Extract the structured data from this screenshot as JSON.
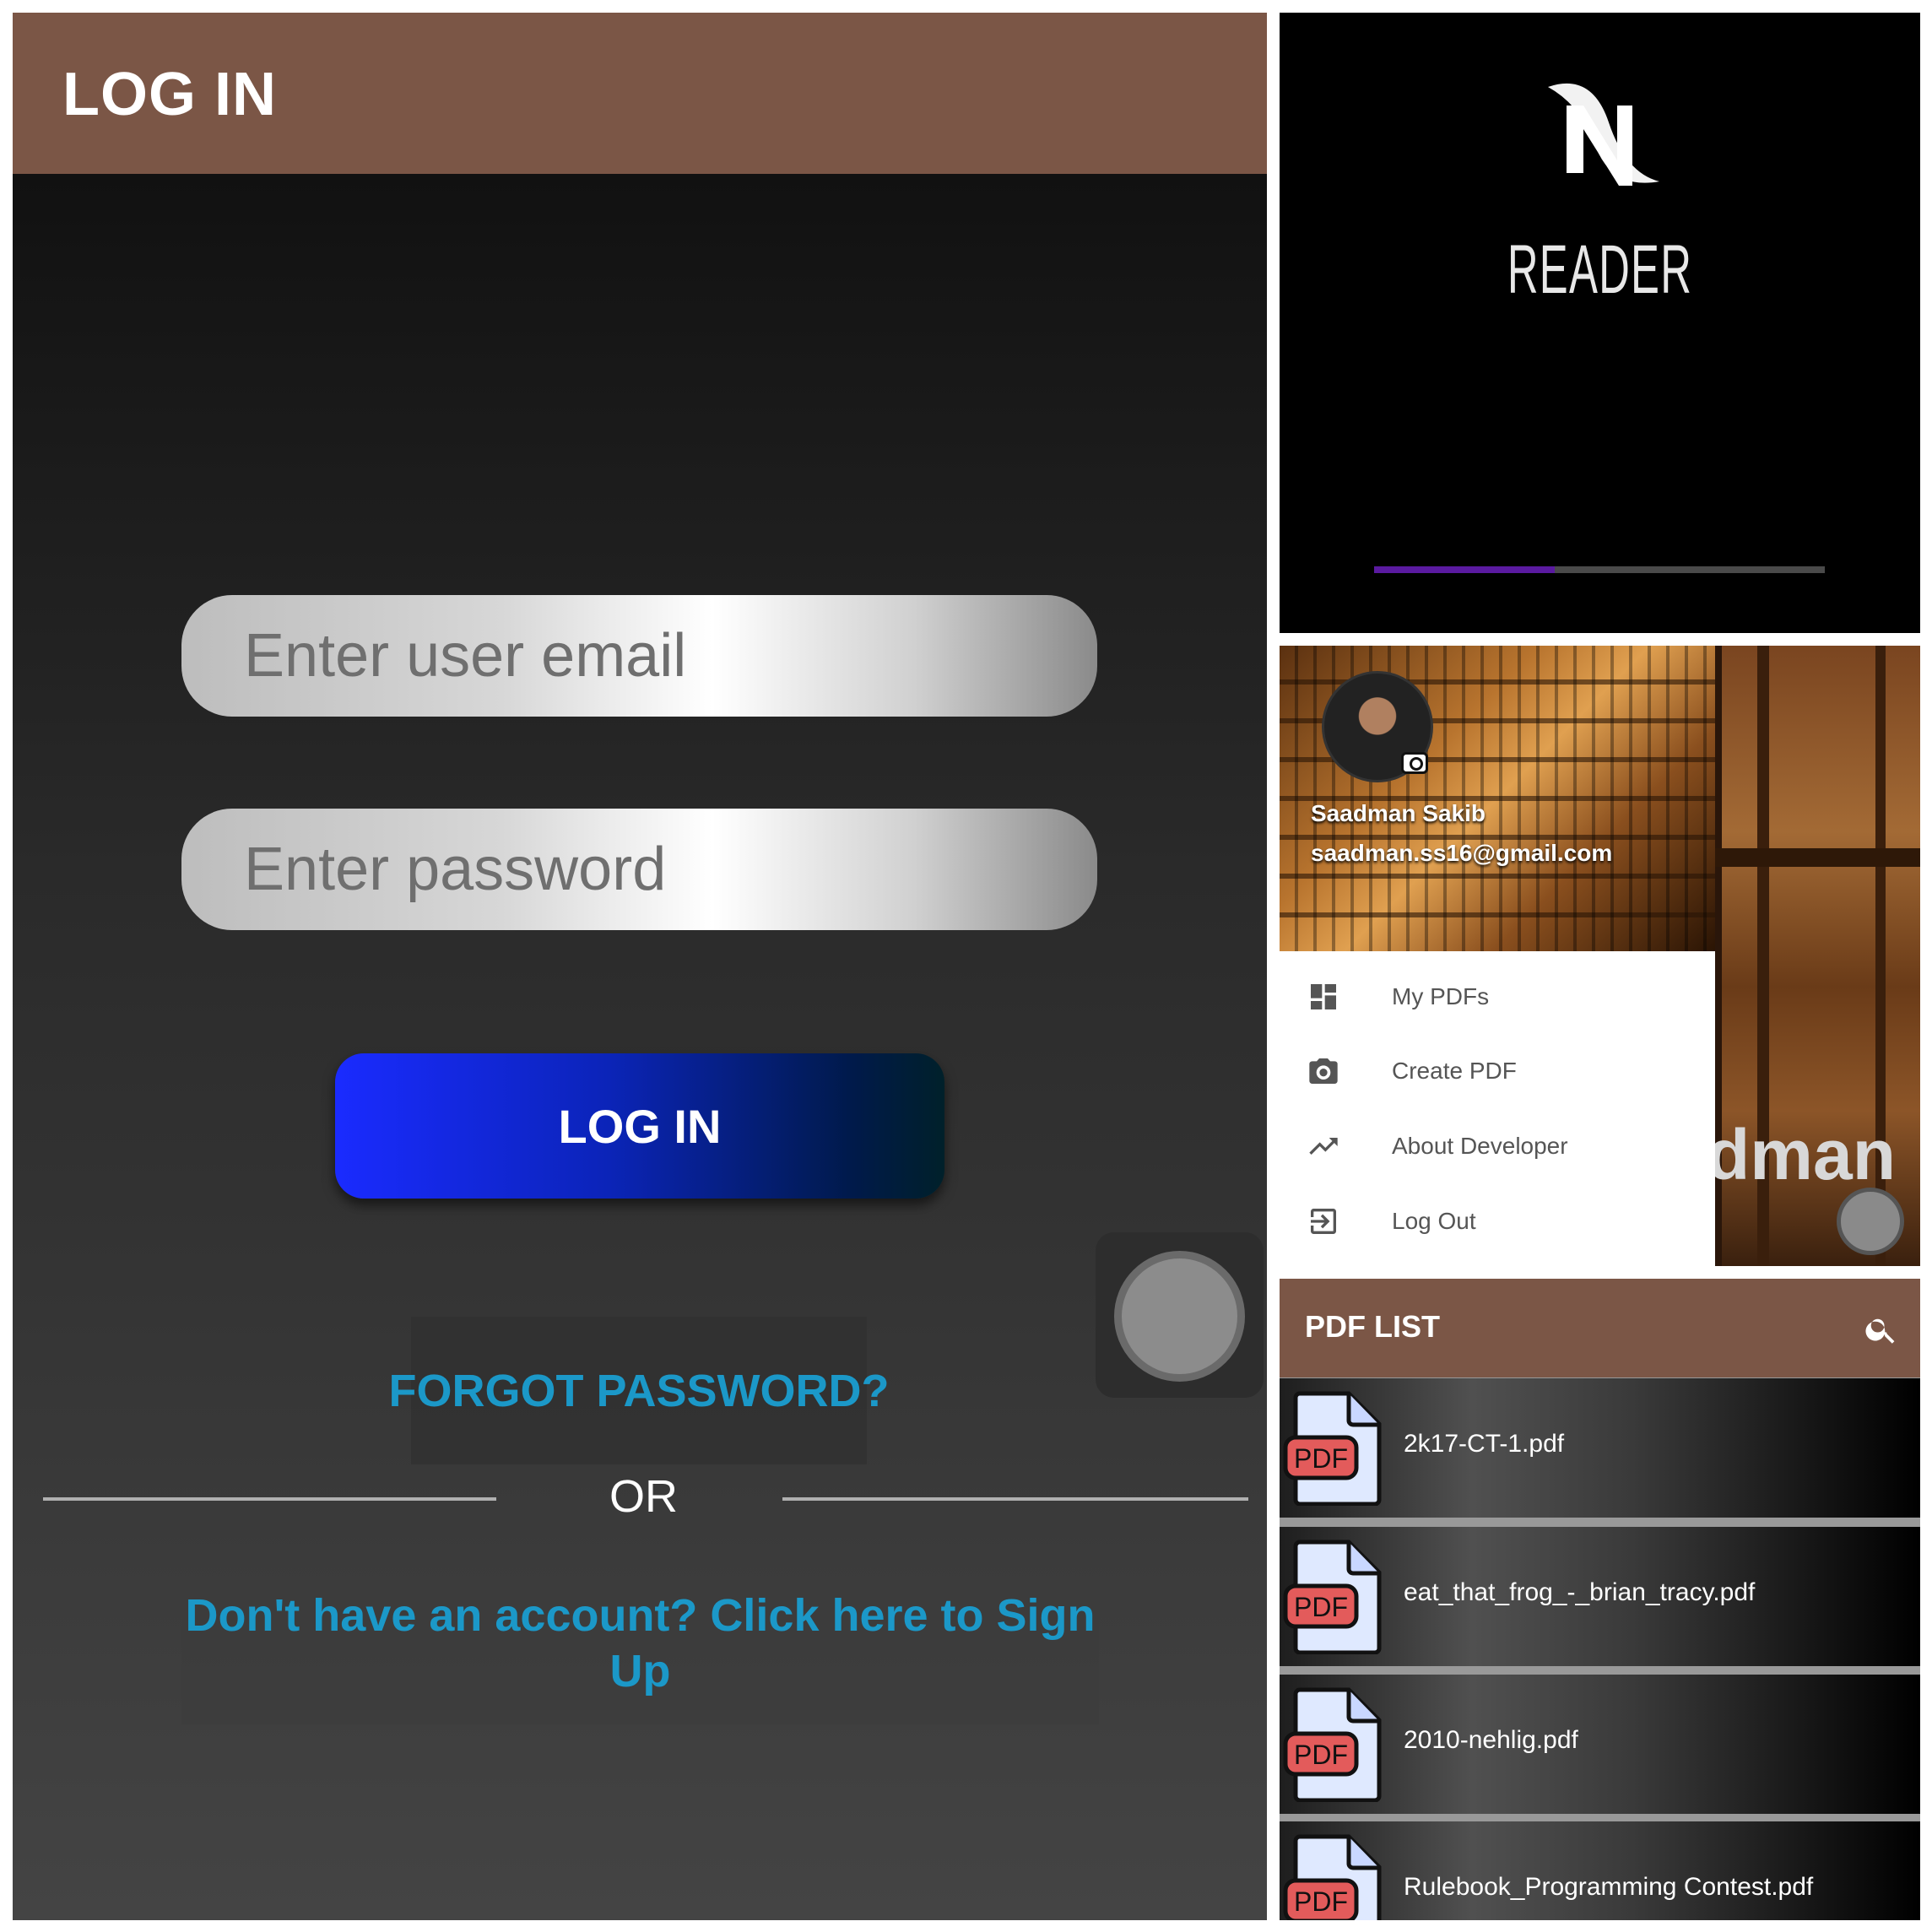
{
  "login": {
    "title": "LOG IN",
    "email_placeholder": "Enter user email",
    "password_placeholder": "Enter password",
    "login_button": "LOG IN",
    "forgot_password": "FORGOT PASSWORD?",
    "or_text": "OR",
    "signup_text": "Don't have an account? Click here to Sign Up"
  },
  "splash": {
    "app_name": "READER",
    "progress": 0.4
  },
  "drawer": {
    "user_name": "Saadman Sakib",
    "user_email": "saadman.ss16@gmail.com",
    "background_name": "dman",
    "menu": [
      {
        "label": "My PDFs",
        "icon": "dashboard-icon"
      },
      {
        "label": "Create PDF",
        "icon": "camera-icon"
      },
      {
        "label": "About Developer",
        "icon": "trending-up-icon"
      },
      {
        "label": "Log Out",
        "icon": "logout-icon"
      }
    ]
  },
  "pdf_list": {
    "title": "PDF LIST",
    "icon_text": "PDF",
    "files": [
      "2k17-CT-1.pdf",
      "eat_that_frog_-_brian_tracy.pdf",
      "2010-nehlig.pdf",
      "Rulebook_Programming Contest.pdf"
    ]
  },
  "colors": {
    "app_bar": "#7b5646",
    "link": "#1b98c8",
    "button_start": "#1a2bff",
    "progress": "#5a1aa0"
  }
}
